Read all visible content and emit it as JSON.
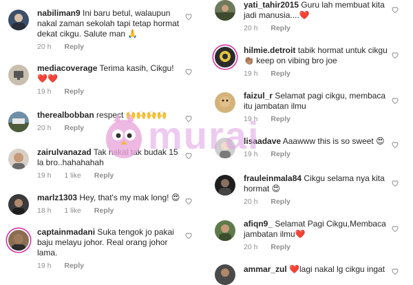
{
  "comments_left": [
    {
      "user": "nabiliman9",
      "text": "Ini baru betul, walaupun nakal zaman sekolah tapi tetap hormat dekat cikgu. Salute man 🙏",
      "time": "20 h",
      "likes": "",
      "reply": "Reply"
    },
    {
      "user": "mediacoverage",
      "text": "Terima kasih, Cikgu! ❤️❤️",
      "time": "19 h",
      "likes": "",
      "reply": "Reply"
    },
    {
      "user": "therealbobban",
      "text": "respect 🙌🙌🙌🙌",
      "time": "20 h",
      "likes": "",
      "reply": "Reply"
    },
    {
      "user": "zairulvanazad",
      "text": "Tak nakal tak budak 15 la bro..hahahahah",
      "time": "19 h",
      "likes": "1 like",
      "reply": "Reply"
    },
    {
      "user": "marlz1303",
      "text": "Hey, that's my mak long! 😍",
      "time": "18 h",
      "likes": "1 like",
      "reply": "Reply"
    },
    {
      "user": "captainmadani",
      "text": "Suka tengok jo pakai baju melayu johor. Real orang johor lama.",
      "time": "19 h",
      "likes": "",
      "reply": "Reply"
    }
  ],
  "comments_right": [
    {
      "user": "yati_tahir2015",
      "text": "Guru lah membuat kita jadi manusia....❤️",
      "time": "20 h",
      "likes": "",
      "reply": "Reply"
    },
    {
      "user": "hilmie.detroit",
      "text": "tabik hormat untuk cikgu 👏🏽 keep on vibing bro joe",
      "time": "19 h",
      "likes": "",
      "reply": "Reply"
    },
    {
      "user": "faizul_r",
      "text": "Selamat pagi cikgu, membaca itu jambatan ilmu",
      "time": "19 h",
      "likes": "",
      "reply": "Reply"
    },
    {
      "user": "lisaadave",
      "text": "Aaawww this is so sweet 😍",
      "time": "19 h",
      "likes": "",
      "reply": "Reply"
    },
    {
      "user": "frauleinmala84",
      "text": "Cikgu selama nya kita hormat 😍",
      "time": "20 h",
      "likes": "",
      "reply": "Reply"
    },
    {
      "user": "afiqn9_",
      "text": "Selamat Pagi Cikgu,Membaca jambatan ilmu❤️",
      "time": "20 h",
      "likes": "",
      "reply": "Reply"
    },
    {
      "user": "ammar_zul",
      "text": "❤️lagi nakal lg cikgu ingat",
      "time": "",
      "likes": "",
      "reply": ""
    }
  ],
  "watermark": {
    "text": "murai"
  },
  "icons": {
    "like": "heart-outline-icon"
  },
  "colors": {
    "meta": "#8e8e8e",
    "text": "#262626",
    "watermark": "#e0a0e4",
    "heart": "#e0242c"
  }
}
